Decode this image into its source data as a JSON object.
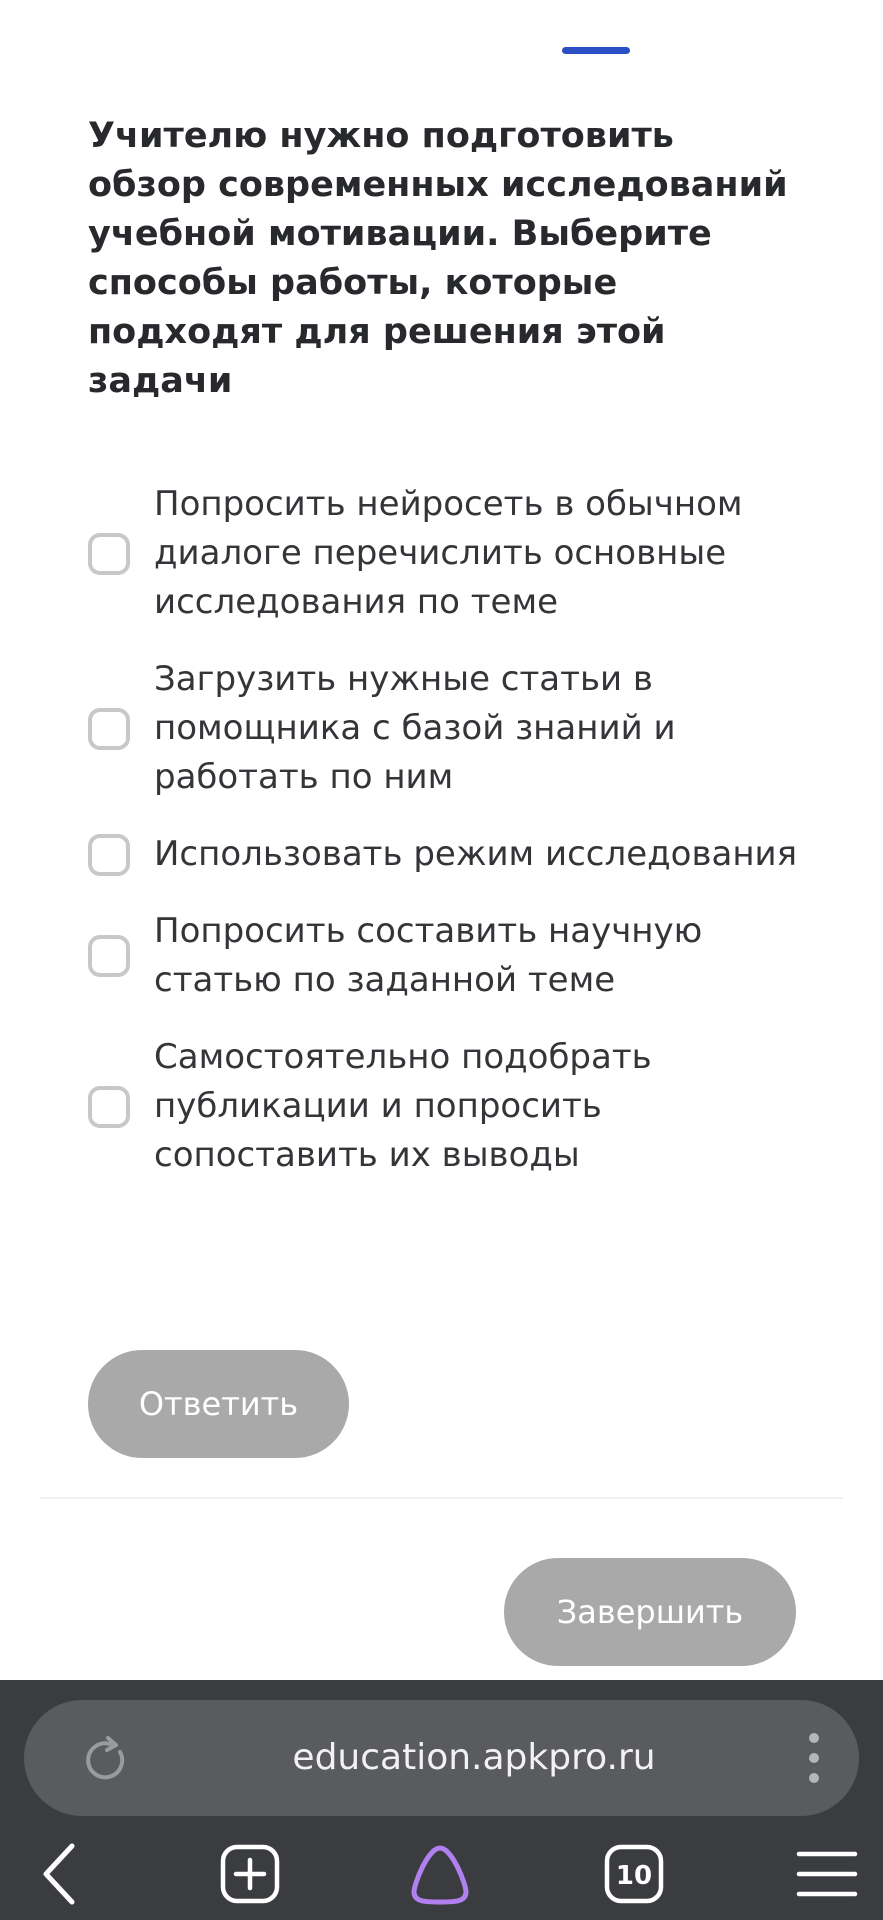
{
  "question": {
    "text": "Учителю нужно подготовить обзор современных исследований учебной мотивации. Выберите способы работы, которые подходят для решения этой задачи"
  },
  "options": [
    {
      "label": "Попросить нейросеть в обычном диалоге перечислить основные исследования по теме",
      "checked": false
    },
    {
      "label": "Загрузить нужные статьи в помощника с базой знаний и работать по ним",
      "checked": false
    },
    {
      "label": "Использовать режим исследования",
      "checked": false
    },
    {
      "label": "Попросить составить научную статью по заданной теме",
      "checked": false
    },
    {
      "label": "Самостоятельно подобрать публикации и попросить сопоставить их выводы",
      "checked": false
    }
  ],
  "buttons": {
    "answer_label": "Ответить",
    "finish_label": "Завершить"
  },
  "browser": {
    "url": "education.apkpro.ru",
    "tab_count": "10",
    "icons": {
      "reload": "reload-icon",
      "more": "more-vertical-icon",
      "back": "back-arrow-icon",
      "new_tab": "new-tab-icon",
      "assistant": "alice-assistant-icon",
      "tabs": "tabs-counter-icon",
      "menu": "hamburger-menu-icon"
    }
  },
  "colors": {
    "accent": "#2b4fc4",
    "button_disabled": "#a9a9a9",
    "browser_bar": "#3b3c3f",
    "assistant": "#b080f0"
  }
}
